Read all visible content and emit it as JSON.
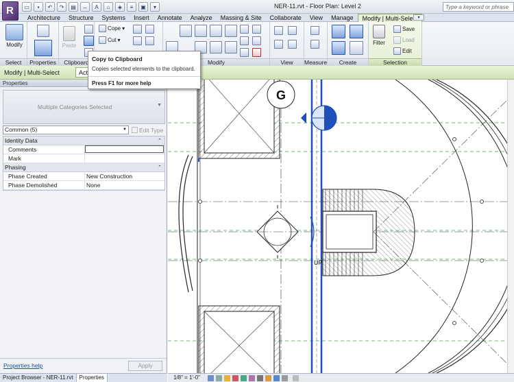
{
  "window": {
    "title": "NER-11.rvt - Floor Plan: Level 2",
    "search_placeholder": "Type a keyword or phrase"
  },
  "quick_access": [
    "open-icon",
    "save-icon",
    "undo-icon",
    "redo-icon",
    "print-icon",
    "measure-icon",
    "text-icon",
    "3d-icon",
    "section-icon",
    "thin-lines-icon",
    "close-hidden-icon",
    "switch-windows-icon"
  ],
  "tabs": [
    "Architecture",
    "Structure",
    "Systems",
    "Insert",
    "Annotate",
    "Analyze",
    "Massing & Site",
    "Collaborate",
    "View",
    "Manage",
    "Modify | Multi-Select"
  ],
  "ribbon": {
    "panels": {
      "select": "Select",
      "properties": "Properties",
      "clipboard": "Clipboard",
      "modify": "Modify",
      "view": "View",
      "measure": "Measure",
      "create": "Create",
      "selection": "Selection"
    },
    "modify_button": "Modify",
    "paste_button": "Paste",
    "cope_button": "Cope",
    "cut_button": "Cut",
    "filter_button": "Filter",
    "save_button": "Save",
    "load_button": "Load",
    "edit_button": "Edit"
  },
  "context_bar": {
    "label": "Modify | Multi-Select",
    "active_field": "Acti"
  },
  "tooltip": {
    "title": "Copy to Clipboard",
    "description": "Copies selected elements to the clipboard.",
    "help": "Press F1 for more help"
  },
  "properties": {
    "header": "Properties",
    "type_name": "Multiple Categories Selected",
    "filter_value": "Common (5)",
    "edit_type": "Edit Type",
    "groups": [
      {
        "name": "Identity Data",
        "rows": [
          {
            "key": "Comments",
            "value": ""
          },
          {
            "key": "Mark",
            "value": ""
          }
        ]
      },
      {
        "name": "Phasing",
        "rows": [
          {
            "key": "Phase Created",
            "value": "New Construction"
          },
          {
            "key": "Phase Demolished",
            "value": "None"
          }
        ]
      }
    ],
    "help_link": "Properties help",
    "apply_button": "Apply"
  },
  "bottom_tabs": {
    "project_browser": "Project Browser - NER-11.rvt",
    "properties": "Properties"
  },
  "drawing": {
    "grid_bubble": "G",
    "stair_label": "UP"
  },
  "status_bar": {
    "scale": "1/8\" = 1'-0\""
  },
  "colors": {
    "context_green": "#d0e3b6",
    "selection_blue": "#1f4fb8",
    "guide_green": "#3fa34d"
  }
}
